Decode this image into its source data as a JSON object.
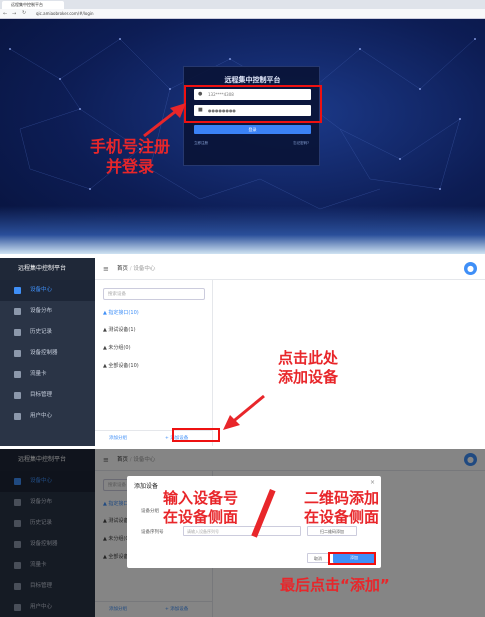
{
  "browser": {
    "tab_title": "远程集中控制平台",
    "url": "qic.amiaobroker.com/#/login"
  },
  "login": {
    "title": "远程集中控制平台",
    "phone_placeholder": "132****4308",
    "password_placeholder": "●●●●●●●●",
    "login_button": "登录",
    "register_link": "立即注册",
    "forgot_link": "忘记密码?",
    "annotation_line1": "手机号注册",
    "annotation_line2": "并登录"
  },
  "sidebar": {
    "title": "远程集中控制平台",
    "items": [
      {
        "label": "设备中心"
      },
      {
        "label": "设备分布"
      },
      {
        "label": "历史记录"
      },
      {
        "label": "设备控制器"
      },
      {
        "label": "流量卡"
      },
      {
        "label": "目标管理"
      },
      {
        "label": "用户中心"
      }
    ]
  },
  "header": {
    "crumb_home": "首页",
    "crumb_sep": "/",
    "crumb_current": "设备中心"
  },
  "tree": {
    "search_placeholder": "搜索设备",
    "nodes": [
      {
        "label": "▲ 指定接口(10)"
      },
      {
        "label": "▲ 测试设备(1)"
      },
      {
        "label": "▲ 未分组(0)"
      },
      {
        "label": "▲ 全部设备(10)"
      }
    ],
    "add_group": "添加分组",
    "add_device": "+ 添加设备"
  },
  "annotation2": {
    "line1": "点击此处",
    "line2": "添加设备"
  },
  "modal": {
    "title": "添加设备",
    "label_group": "设备分组",
    "label_serial": "设备序列号",
    "serial_placeholder": "请输入设备序列号",
    "qr_button": "扫二维码添加",
    "cancel": "取消",
    "add": "添加"
  },
  "annotation3": {
    "left_line1": "输入设备号",
    "left_line2": "在设备侧面",
    "right_line1": "二维码添加",
    "right_line2": "在设备侧面",
    "bottom": "最后点击“添加”"
  },
  "colors": {
    "accent": "#3f8ff7",
    "annotation": "#e8262a",
    "sidebar": "#2a3446"
  }
}
